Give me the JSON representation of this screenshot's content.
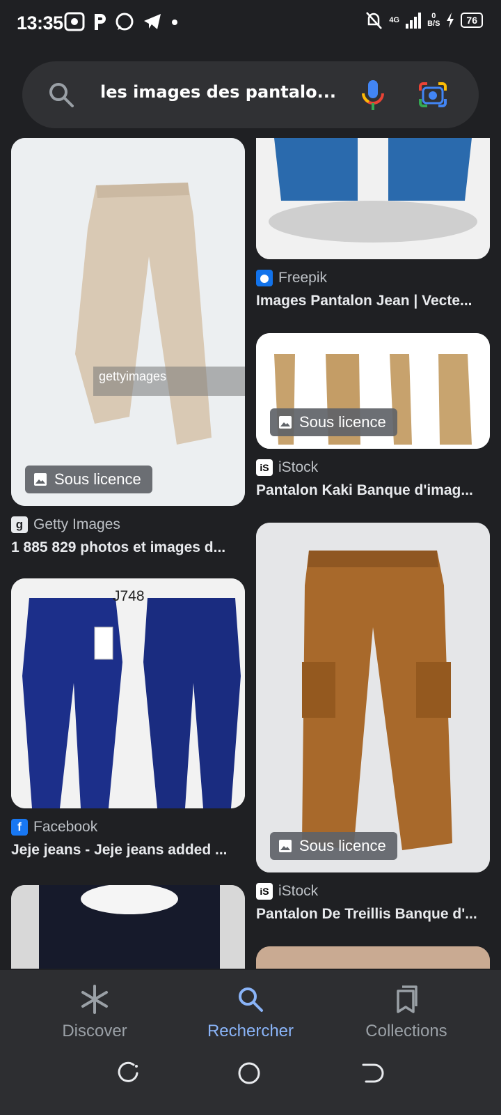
{
  "status": {
    "time": "13:35",
    "network": "4G",
    "speed_value": "0",
    "speed_unit": "B/S",
    "battery": "76"
  },
  "search": {
    "query": "les images des pantalo..."
  },
  "results": [
    {
      "source": "Getty Images",
      "title": "1 885 829 photos et images d...",
      "badge": "Sous licence",
      "watermark": "gettyimages",
      "favicon_letter": "g"
    },
    {
      "source": "Facebook",
      "title": "Jeje jeans - Jeje jeans added ...",
      "label": "J748",
      "favicon_letter": "f"
    },
    {
      "source": "Freepik",
      "title": "Images Pantalon Jean | Vecte..."
    },
    {
      "source": "iStock",
      "title": "Pantalon Kaki Banque d'imag...",
      "badge": "Sous licence",
      "favicon_letter": "iS"
    },
    {
      "source": "iStock",
      "title": "Pantalon De Treillis Banque d'...",
      "badge": "Sous licence",
      "favicon_letter": "iS"
    }
  ],
  "nav": {
    "discover": "Discover",
    "search": "Rechercher",
    "collections": "Collections"
  },
  "colors": {
    "accent": "#8ab4f8",
    "background": "#1f2023",
    "nav_background": "#2d2e31"
  }
}
